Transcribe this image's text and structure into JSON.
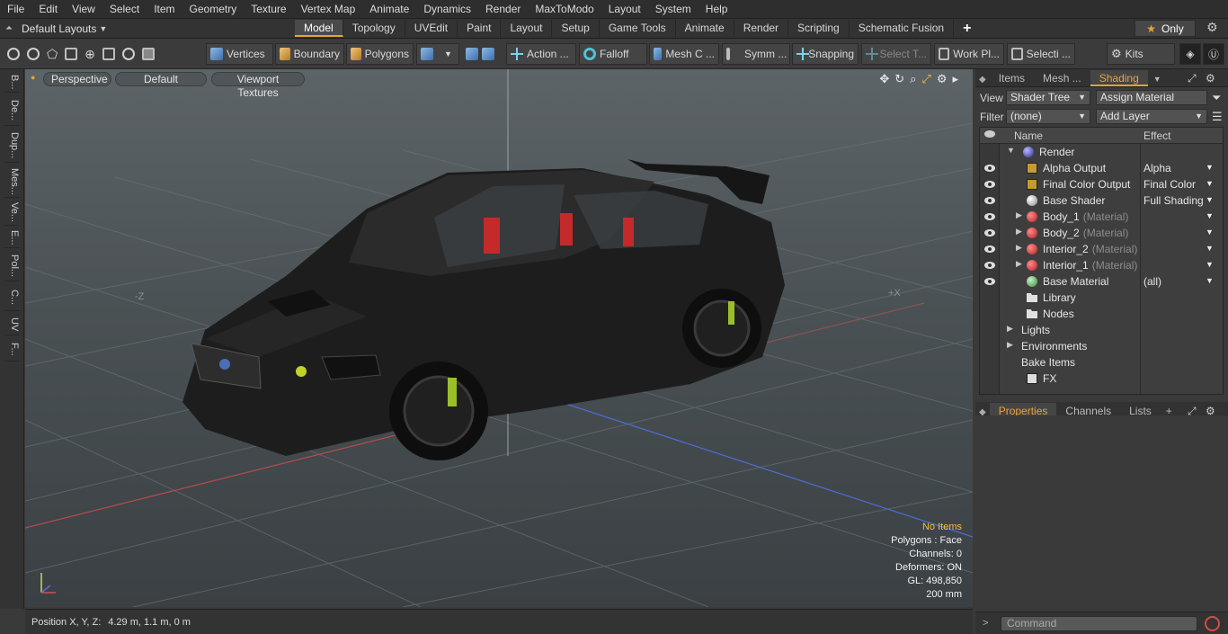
{
  "menu": [
    "File",
    "Edit",
    "View",
    "Select",
    "Item",
    "Geometry",
    "Texture",
    "Vertex Map",
    "Animate",
    "Dynamics",
    "Render",
    "MaxToModo",
    "Layout",
    "System",
    "Help"
  ],
  "layout_selector": "Default Layouts",
  "tabs": [
    "Model",
    "Topology",
    "UVEdit",
    "Paint",
    "Layout",
    "Setup",
    "Game Tools",
    "Animate",
    "Render",
    "Scripting",
    "Schematic Fusion"
  ],
  "active_tab": "Model",
  "only_label": "Only",
  "toolbar": {
    "vertices": "Vertices",
    "boundary": "Boundary",
    "polygons": "Polygons",
    "action": "Action ...",
    "falloff": "Falloff",
    "mesh": "Mesh C ...",
    "symm": "Symm ...",
    "snapping": "Snapping",
    "select_t": "Select T...",
    "work_pl": "Work Pl...",
    "selecti": "Selecti ...",
    "kits": "Kits"
  },
  "left_tabs": [
    "B...",
    "De...",
    "Dup...",
    "Mes...",
    "Ve...",
    "E...",
    "Pol...",
    "C...",
    "UV",
    "F..."
  ],
  "viewport": {
    "perspective": "Perspective",
    "default": "Default",
    "viewport_textures": "Viewport Textures",
    "axis_neg_z": "-Z",
    "axis_pos_x": "+X",
    "info": {
      "no_items": "No Items",
      "polygons": "Polygons : Face",
      "channels": "Channels: 0",
      "deformers": "Deformers: ON",
      "gl": "GL: 498,850",
      "scale": "200 mm"
    }
  },
  "status": {
    "label": "Position X, Y, Z:",
    "value": "4.29 m, 1.1 m, 0 m"
  },
  "panel_tabs": [
    "Items",
    "Mesh ...",
    "Shading"
  ],
  "active_panel_tab": "Shading",
  "shading": {
    "view_label": "View",
    "view_value": "Shader Tree",
    "assign_material": "Assign Material",
    "filter_label": "Filter",
    "filter_value": "(none)",
    "add_layer": "Add Layer",
    "col_name": "Name",
    "col_effect": "Effect",
    "rows": [
      {
        "name": "Render",
        "sub": "",
        "effect": "",
        "indent": 0,
        "icon": "render-sphere-icon",
        "arrow": "▼",
        "eye": false
      },
      {
        "name": "Alpha Output",
        "sub": "",
        "effect": "Alpha",
        "indent": 1,
        "icon": "output-image-icon",
        "arrow": "",
        "eye": true
      },
      {
        "name": "Final Color Output",
        "sub": "",
        "effect": "Final Color",
        "indent": 1,
        "icon": "output-image-icon",
        "arrow": "",
        "eye": true
      },
      {
        "name": "Base Shader",
        "sub": "",
        "effect": "Full Shading",
        "indent": 1,
        "icon": "shader-ball-icon",
        "arrow": "",
        "eye": true
      },
      {
        "name": "Body_1",
        "sub": "(Material)",
        "effect": "",
        "indent": 1,
        "icon": "material-group-icon",
        "arrow": "▶",
        "eye": true
      },
      {
        "name": "Body_2",
        "sub": "(Material)",
        "effect": "",
        "indent": 1,
        "icon": "material-group-icon",
        "arrow": "▶",
        "eye": true
      },
      {
        "name": "Interior_2",
        "sub": "(Material)",
        "effect": "",
        "indent": 1,
        "icon": "material-group-icon",
        "arrow": "▶",
        "eye": true
      },
      {
        "name": "Interior_1",
        "sub": "(Material)",
        "effect": "",
        "indent": 1,
        "icon": "material-group-icon",
        "arrow": "▶",
        "eye": true
      },
      {
        "name": "Base Material",
        "sub": "",
        "effect": "(all)",
        "indent": 1,
        "icon": "base-material-icon",
        "arrow": "",
        "eye": true
      },
      {
        "name": "Library",
        "sub": "",
        "effect": "",
        "indent": 1,
        "icon": "folder-icon",
        "arrow": "",
        "eye": false
      },
      {
        "name": "Nodes",
        "sub": "",
        "effect": "",
        "indent": 1,
        "icon": "folder-icon",
        "arrow": "",
        "eye": false
      },
      {
        "name": "Lights",
        "sub": "",
        "effect": "",
        "indent": 0,
        "icon": "",
        "arrow": "▶",
        "eye": false
      },
      {
        "name": "Environments",
        "sub": "",
        "effect": "",
        "indent": 0,
        "icon": "",
        "arrow": "▶",
        "eye": false
      },
      {
        "name": "Bake Items",
        "sub": "",
        "effect": "",
        "indent": 0,
        "icon": "",
        "arrow": "",
        "eye": false
      },
      {
        "name": "FX",
        "sub": "",
        "effect": "",
        "indent": 1,
        "icon": "fx-clapper-icon",
        "arrow": "",
        "eye": false
      }
    ]
  },
  "props_tabs": [
    "Properties",
    "Channels",
    "Lists"
  ],
  "active_props_tab": "Properties",
  "command_placeholder": "Command",
  "colors": {
    "accent": "#e8a23b",
    "viewport_top": "#5d6468",
    "viewport_bottom": "#3a4043"
  }
}
